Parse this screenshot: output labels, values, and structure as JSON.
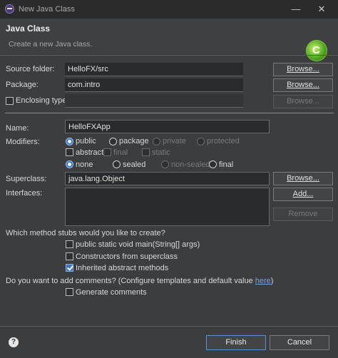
{
  "window": {
    "title": "New Java Class",
    "minimize_glyph": "—",
    "close_glyph": "✕"
  },
  "header": {
    "title": "Java Class",
    "description": "Create a new Java class.",
    "logo_glyph": "C"
  },
  "source_folder": {
    "label": "Source folder:",
    "value": "HelloFX/src",
    "browse": "Browse..."
  },
  "package": {
    "label": "Package:",
    "value": "com.intro",
    "browse": "Browse..."
  },
  "enclosing": {
    "label": "Enclosing type:",
    "value": "",
    "browse": "Browse...",
    "checked": false
  },
  "name": {
    "label": "Name:",
    "value": "HelloFXApp"
  },
  "modifiers": {
    "label": "Modifiers:",
    "access": [
      "public",
      "package",
      "private",
      "protected"
    ],
    "access_selected": "public",
    "flags": [
      "abstract",
      "final",
      "static"
    ],
    "inheritance": [
      "none",
      "sealed",
      "non-sealed",
      "final"
    ],
    "inheritance_selected": "none"
  },
  "superclass": {
    "label": "Superclass:",
    "value": "java.lang.Object",
    "browse": "Browse..."
  },
  "interfaces": {
    "label": "Interfaces:",
    "add": "Add...",
    "remove": "Remove"
  },
  "stubs": {
    "question": "Which method stubs would you like to create?",
    "items": [
      {
        "label": "public static void main(String[] args)",
        "checked": false
      },
      {
        "label": "Constructors from superclass",
        "checked": false
      },
      {
        "label": "Inherited abstract methods",
        "checked": true
      }
    ]
  },
  "comments": {
    "question_prefix": "Do you want to add comments? (Configure templates and default value ",
    "link": "here",
    "question_suffix": ")",
    "generate_label": "Generate comments",
    "checked": false
  },
  "footer": {
    "help_glyph": "?",
    "finish": "Finish",
    "cancel": "Cancel"
  },
  "colors": {
    "background": "#3b3d3f",
    "titlebar": "#2b2b2b",
    "accent": "#3c77c0",
    "link": "#6fa8e8"
  },
  "icons": [
    "app-icon",
    "java-class-logo-icon",
    "help-icon"
  ]
}
